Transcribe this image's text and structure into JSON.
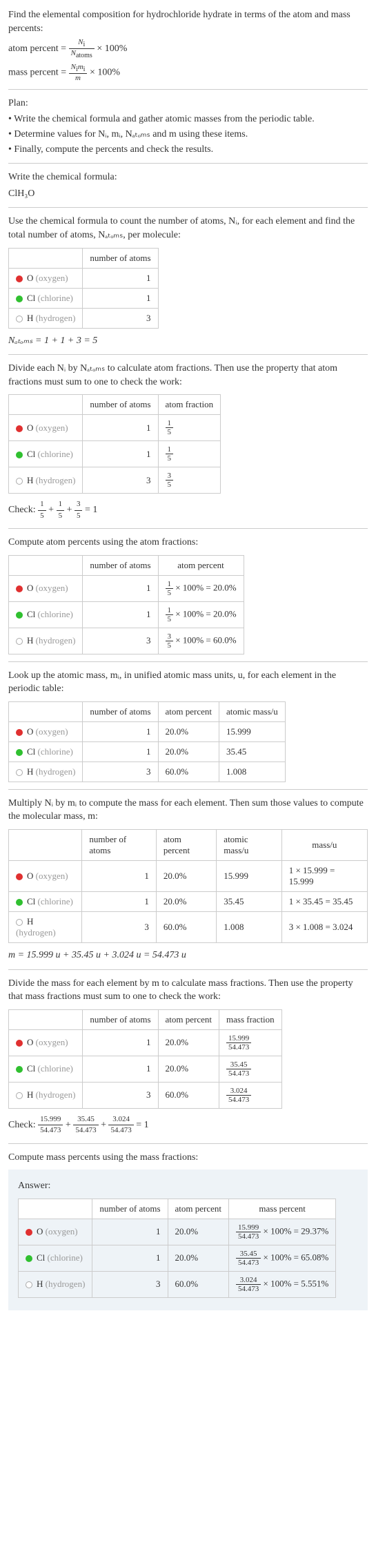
{
  "intro": {
    "line1": "Find the elemental composition for hydrochloride hydrate in terms of the atom and mass percents:",
    "atom_percent_label": "atom percent = ",
    "atom_percent_rhs": " × 100%",
    "mass_percent_label": "mass percent = ",
    "mass_percent_rhs": " × 100%",
    "Ni": "N",
    "Ni_sub": "i",
    "Natoms": "N",
    "Natoms_sub": "atoms",
    "Nimi_num": "N",
    "Nimi_num_sub_i": "i",
    "Nimi_num_m": "m",
    "Nimi_num_sub_i2": "i",
    "m": "m"
  },
  "plan": {
    "label": "Plan:",
    "items": [
      "• Write the chemical formula and gather atomic masses from the periodic table.",
      "• Determine values for Nᵢ, mᵢ, Nₐₜₒₘₛ and m using these items.",
      "• Finally, compute the percents and check the results."
    ]
  },
  "write_formula": {
    "p": "Write the chemical formula:",
    "formula": "ClH₃O"
  },
  "count_atoms": {
    "p": "Use the chemical formula to count the number of atoms, Nᵢ, for each element and find the total number of atoms, Nₐₜₒₘₛ, per molecule:",
    "headers": [
      "",
      "number of atoms"
    ],
    "o_label_sym": "O",
    "o_label_sec": " (oxygen)",
    "o_val": "1",
    "cl_label_sym": "Cl",
    "cl_label_sec": " (chlorine)",
    "cl_val": "1",
    "h_label_sym": "H",
    "h_label_sec": " (hydrogen)",
    "h_val": "3",
    "sum": "Nₐₜₒₘₛ = 1 + 1 + 3 = 5"
  },
  "atom_fractions": {
    "p": "Divide each Nᵢ by Nₐₜₒₘₛ to calculate atom fractions. Then use the property that atom fractions must sum to one to check the work:",
    "headers": [
      "",
      "number of atoms",
      "atom fraction"
    ],
    "rows": [
      {
        "sym": "O",
        "sec": " (oxygen)",
        "n": "1",
        "fnum": "1",
        "fden": "5"
      },
      {
        "sym": "Cl",
        "sec": " (chlorine)",
        "n": "1",
        "fnum": "1",
        "fden": "5"
      },
      {
        "sym": "H",
        "sec": " (hydrogen)",
        "n": "3",
        "fnum": "3",
        "fden": "5"
      }
    ],
    "check_label": "Check: ",
    "check_eq": " = 1"
  },
  "atom_percents": {
    "p": "Compute atom percents using the atom fractions:",
    "headers": [
      "",
      "number of atoms",
      "atom percent"
    ],
    "rows": [
      {
        "sym": "O",
        "sec": " (oxygen)",
        "n": "1",
        "fnum": "1",
        "fden": "5",
        "res": " × 100% = 20.0%"
      },
      {
        "sym": "Cl",
        "sec": " (chlorine)",
        "n": "1",
        "fnum": "1",
        "fden": "5",
        "res": " × 100% = 20.0%"
      },
      {
        "sym": "H",
        "sec": " (hydrogen)",
        "n": "3",
        "fnum": "3",
        "fden": "5",
        "res": " × 100% = 60.0%"
      }
    ]
  },
  "atomic_mass": {
    "p": "Look up the atomic mass, mᵢ, in unified atomic mass units, u, for each element in the periodic table:",
    "headers": [
      "",
      "number of atoms",
      "atom percent",
      "atomic mass/u"
    ],
    "rows": [
      {
        "sym": "O",
        "sec": " (oxygen)",
        "n": "1",
        "pct": "20.0%",
        "mass": "15.999"
      },
      {
        "sym": "Cl",
        "sec": " (chlorine)",
        "n": "1",
        "pct": "20.0%",
        "mass": "35.45"
      },
      {
        "sym": "H",
        "sec": " (hydrogen)",
        "n": "3",
        "pct": "60.0%",
        "mass": "1.008"
      }
    ]
  },
  "mass_each": {
    "p": "Multiply Nᵢ by mᵢ to compute the mass for each element. Then sum those values to compute the molecular mass, m:",
    "headers": [
      "",
      "number of atoms",
      "atom percent",
      "atomic mass/u",
      "mass/u"
    ],
    "rows": [
      {
        "sym": "O",
        "sec": " (oxygen)",
        "n": "1",
        "pct": "20.0%",
        "mass": "15.999",
        "calc": "1 × 15.999 = 15.999"
      },
      {
        "sym": "Cl",
        "sec": " (chlorine)",
        "n": "1",
        "pct": "20.0%",
        "mass": "35.45",
        "calc": "1 × 35.45 = 35.45"
      },
      {
        "sym": "H",
        "sec": " (hydrogen)",
        "n": "3",
        "pct": "60.0%",
        "mass": "1.008",
        "calc": "3 × 1.008 = 3.024"
      }
    ],
    "sum": "m = 15.999 u + 35.45 u + 3.024 u = 54.473 u"
  },
  "mass_fractions": {
    "p": "Divide the mass for each element by m to calculate mass fractions. Then use the property that mass fractions must sum to one to check the work:",
    "headers": [
      "",
      "number of atoms",
      "atom percent",
      "mass fraction"
    ],
    "rows": [
      {
        "sym": "O",
        "sec": " (oxygen)",
        "n": "1",
        "pct": "20.0%",
        "fnum": "15.999",
        "fden": "54.473"
      },
      {
        "sym": "Cl",
        "sec": " (chlorine)",
        "n": "1",
        "pct": "20.0%",
        "fnum": "35.45",
        "fden": "54.473"
      },
      {
        "sym": "H",
        "sec": " (hydrogen)",
        "n": "3",
        "pct": "60.0%",
        "fnum": "3.024",
        "fden": "54.473"
      }
    ],
    "check_label": "Check: ",
    "check_eq": " = 1"
  },
  "mass_percents": {
    "p": "Compute mass percents using the mass fractions:"
  },
  "answer": {
    "label": "Answer:",
    "headers": [
      "",
      "number of atoms",
      "atom percent",
      "mass percent"
    ],
    "rows": [
      {
        "sym": "O",
        "sec": " (oxygen)",
        "n": "1",
        "pct": "20.0%",
        "fnum": "15.999",
        "fden": "54.473",
        "res": " × 100% = 29.37%"
      },
      {
        "sym": "Cl",
        "sec": " (chlorine)",
        "n": "1",
        "pct": "20.0%",
        "fnum": "35.45",
        "fden": "54.473",
        "res": " × 100% = 65.08%"
      },
      {
        "sym": "H",
        "sec": " (hydrogen)",
        "n": "3",
        "pct": "60.0%",
        "fnum": "3.024",
        "fden": "54.473",
        "res": " × 100% = 5.551%"
      }
    ]
  }
}
